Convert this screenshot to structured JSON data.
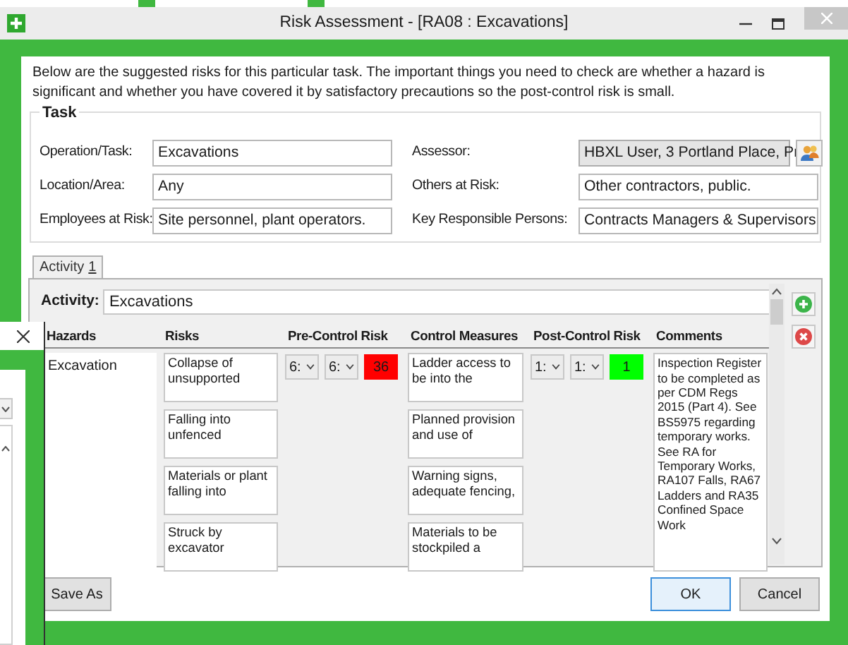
{
  "window": {
    "title": "Risk Assessment - [RA08 : Excavations]"
  },
  "intro": "Below are the suggested risks for this particular task. The important things you need to check are whether a hazard is significant and whether you have covered it by satisfactory precautions so the post-control risk is small.",
  "task": {
    "legend": "Task",
    "fields": [
      {
        "label": "Operation/Task:",
        "value": "Excavations",
        "kind": "text"
      },
      {
        "label": "Assessor:",
        "value": "HBXL User, 3 Portland Place, Pr",
        "kind": "dropdown"
      },
      {
        "label": "Location/Area:",
        "value": "Any",
        "kind": "text"
      },
      {
        "label": "Others at Risk:",
        "value": "Other contractors, public.",
        "kind": "text"
      },
      {
        "label": "Employees at Risk:",
        "value": "Site personnel, plant operators.",
        "kind": "text"
      },
      {
        "label": "Key Responsible Persons:",
        "value": "Contracts Managers & Supervisors",
        "kind": "text"
      }
    ]
  },
  "tabs": [
    {
      "label": "Activity",
      "number": "1",
      "selected": true
    }
  ],
  "activity": {
    "label": "Activity:",
    "value": "Excavations"
  },
  "columns": [
    "Hazards",
    "Risks",
    "Pre-Control Risk",
    "Control Measures",
    "Post-Control Risk",
    "Comments"
  ],
  "hazard": {
    "text": "Excavation",
    "risks": [
      "Collapse of unsupported",
      "Falling into unfenced",
      "Materials or plant falling into",
      "Struck by excavator"
    ],
    "pre_control": {
      "likelihood": "6:",
      "severity": "6:",
      "score": "36",
      "color": "#ff0000"
    },
    "control_measures": [
      "Ladder access to be into the",
      "Planned provision and use of",
      "Warning signs, adequate fencing,",
      "Materials to be stockpiled a"
    ],
    "post_control": {
      "likelihood": "1:",
      "severity": "1:",
      "score": "1",
      "color": "#00ff00"
    },
    "comment": "Inspection Register to be completed as per CDM Regs 2015 (Part 4). See BS5975 regarding temporary works. See RA for Temporary Works, RA107 Falls, RA67 Ladders and RA35 Confined Space Work"
  },
  "buttons": [
    {
      "label": "Save As",
      "kind": "secondary"
    },
    {
      "label": "OK",
      "kind": "default"
    },
    {
      "label": "Cancel",
      "kind": "secondary"
    }
  ]
}
